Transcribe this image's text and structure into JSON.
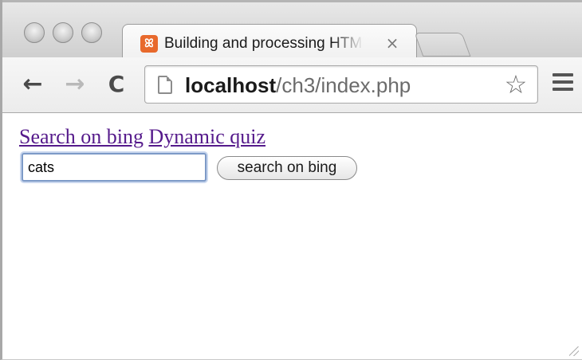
{
  "browser": {
    "tab": {
      "favicon": "xampp-icon",
      "title": "Building and processing HTML",
      "close_symbol": "×"
    },
    "toolbar": {
      "back_symbol": "←",
      "forward_symbol": "→",
      "reload_symbol": "C",
      "url_host": "localhost",
      "url_path": "/ch3/index.php",
      "star_symbol": "☆"
    }
  },
  "page": {
    "links": [
      {
        "label": "Search on bing"
      },
      {
        "label": "Dynamic quiz"
      }
    ],
    "search": {
      "value": "cats",
      "button_label": "search on bing"
    }
  },
  "colors": {
    "link_visited": "#551a8b",
    "favicon_orange": "#e8692c",
    "input_focus": "#7d9ac7"
  }
}
